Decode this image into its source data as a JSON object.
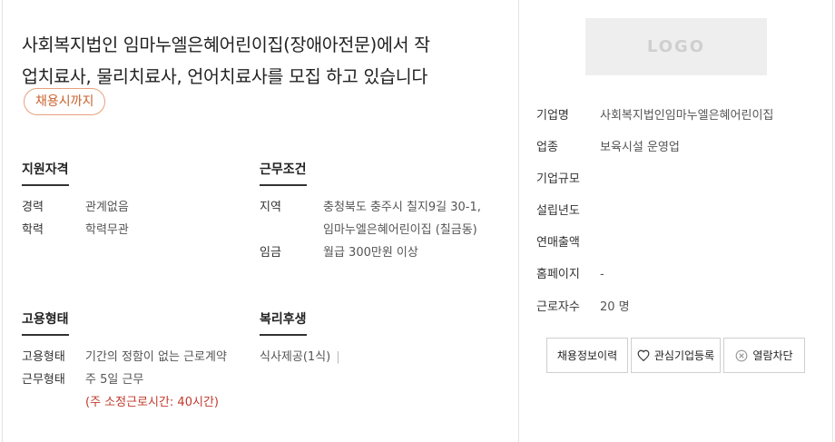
{
  "job": {
    "title_line1": "사회복지법인 임마누엘은혜어린이집(장애아전문)에서 작",
    "title_line2": "업치료사, 물리치료사, 언어치료사를 모집 하고 있습니다",
    "deadline_badge": "채용시까지"
  },
  "qualifications": {
    "heading": "지원자격",
    "rows": [
      {
        "label": "경력",
        "value": "관계없음"
      },
      {
        "label": "학력",
        "value": "학력무관"
      }
    ]
  },
  "conditions": {
    "heading": "근무조건",
    "region_label": "지역",
    "region_line1": "충청북도 충주시 칠지9길 30-1,",
    "region_line2": "임마누엘은혜어린이집 (칠금동)",
    "salary_label": "임금",
    "salary_value": "월급 300만원 이상"
  },
  "employment": {
    "heading": "고용형태",
    "type_label": "고용형태",
    "type_value": "기간의 정함이 없는 근로계약",
    "work_label": "근무형태",
    "work_value": "주 5일 근무",
    "work_note": "(주 소정근로시간: 40시간)"
  },
  "welfare": {
    "heading": "복리후생",
    "value": "식사제공(1식)",
    "separator": "|"
  },
  "company": {
    "logo_text": "LOGO",
    "rows": [
      {
        "label": "기업명",
        "value": "사회복지법인임마누엘은혜어린이집"
      },
      {
        "label": "업종",
        "value": "보육시설 운영업"
      },
      {
        "label": "기업규모",
        "value": ""
      },
      {
        "label": "설립년도",
        "value": ""
      },
      {
        "label": "연매출액",
        "value": ""
      },
      {
        "label": "홈페이지",
        "value": "-"
      },
      {
        "label": "근로자수",
        "value": "20 명"
      }
    ]
  },
  "actions": {
    "history_label": "채용정보이력",
    "favorite_label": "관심기업등록",
    "block_label": "열람차단"
  },
  "colors": {
    "badge_accent": "#c9622f",
    "note_red": "#c0392b"
  }
}
